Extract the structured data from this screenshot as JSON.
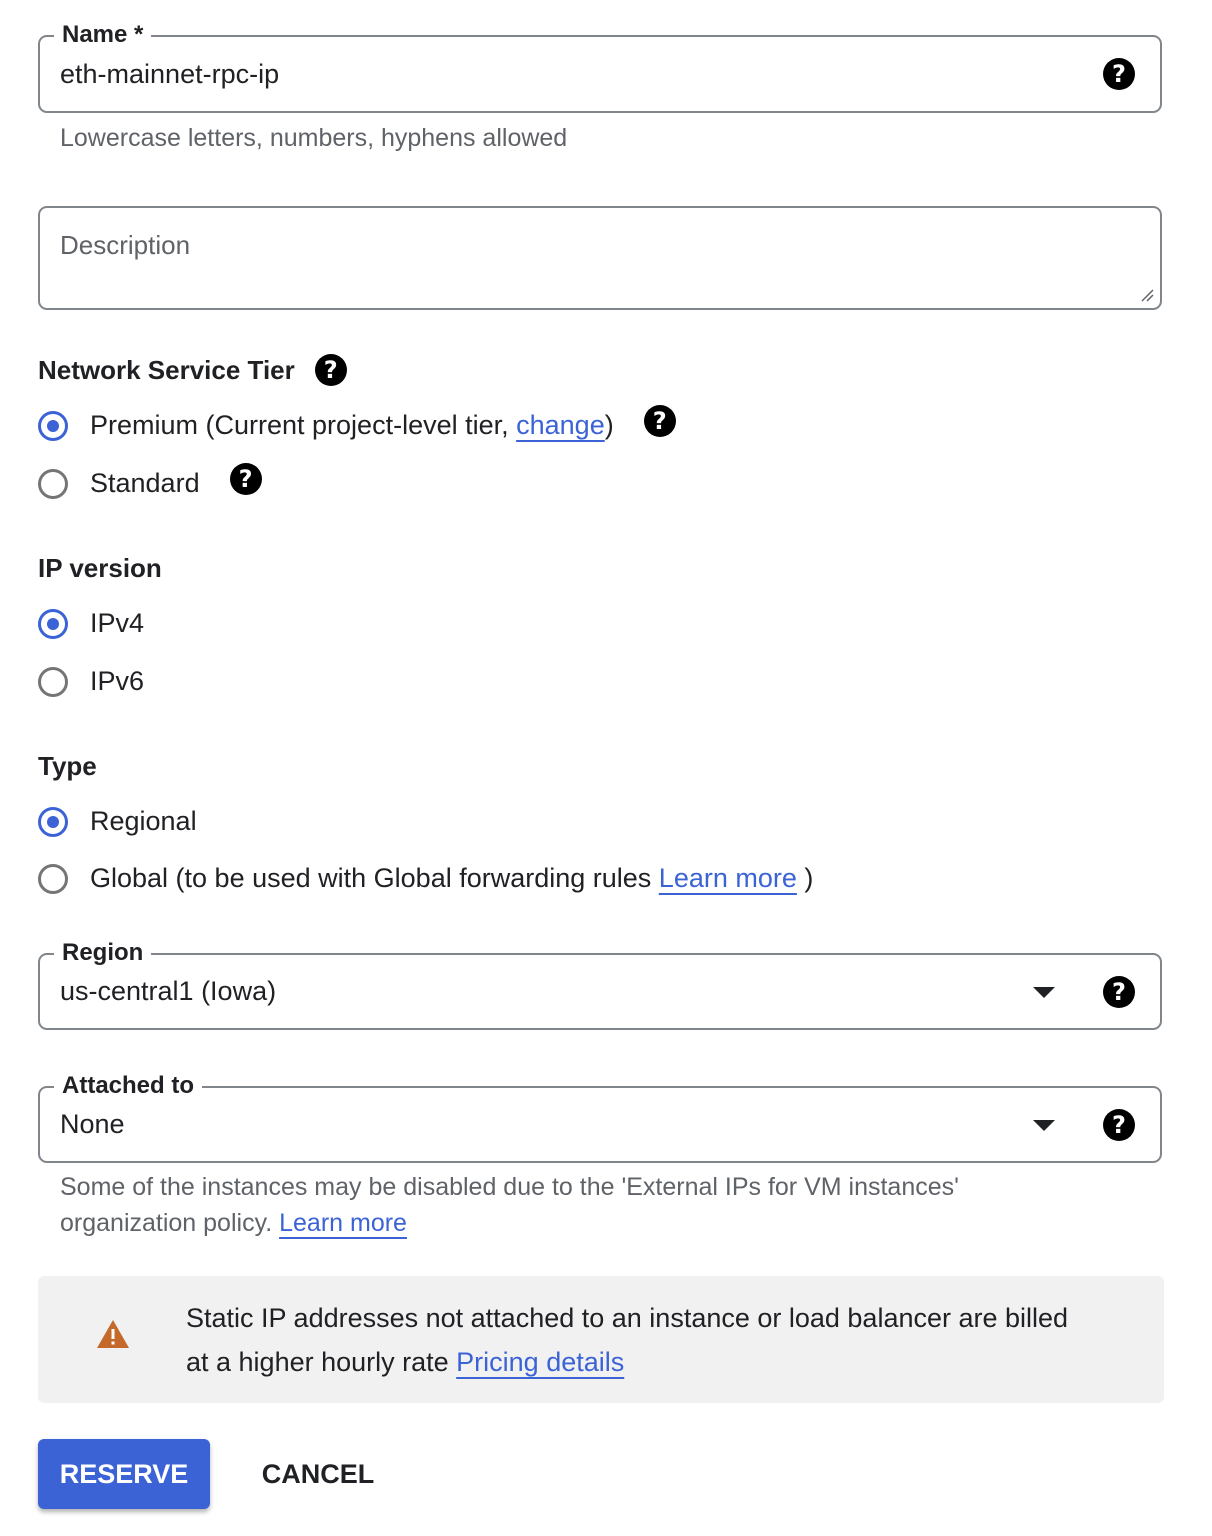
{
  "name_field": {
    "label": "Name *",
    "value": "eth-mainnet-rpc-ip",
    "hint": "Lowercase letters, numbers, hyphens allowed",
    "help_icon": "help-circle-icon"
  },
  "description_field": {
    "placeholder": "Description",
    "value": ""
  },
  "network_service_tier": {
    "title": "Network Service Tier",
    "options": [
      {
        "label_prefix": "Premium (Current project-level tier, ",
        "link": "change",
        "label_suffix": ")",
        "selected": true
      },
      {
        "label": "Standard",
        "selected": false
      }
    ]
  },
  "ip_version": {
    "title": "IP version",
    "options": [
      {
        "label": "IPv4",
        "selected": true
      },
      {
        "label": "IPv6",
        "selected": false
      }
    ]
  },
  "type": {
    "title": "Type",
    "options": [
      {
        "label": "Regional",
        "selected": true
      },
      {
        "label_prefix": "Global (to be used with Global forwarding rules ",
        "link": "Learn more",
        "label_suffix": " )",
        "selected": false
      }
    ]
  },
  "region_field": {
    "label": "Region",
    "value": "us-central1 (Iowa)"
  },
  "attached_field": {
    "label": "Attached to",
    "value": "None",
    "hint_line1": "Some of the instances may be disabled due to the 'External IPs for VM instances'",
    "hint_line2_prefix": "organization policy. ",
    "hint_link": "Learn more"
  },
  "notice": {
    "icon": "warning-icon",
    "line1": "Static IP addresses not attached to an instance or load balancer are billed",
    "line2_prefix": "at a higher hourly rate ",
    "link": "Pricing details"
  },
  "actions": {
    "reserve": "RESERVE",
    "cancel": "CANCEL"
  },
  "colors": {
    "accent": "#3b63d6",
    "warning": "#c5692b",
    "notice_bg": "#f1f1f1"
  }
}
